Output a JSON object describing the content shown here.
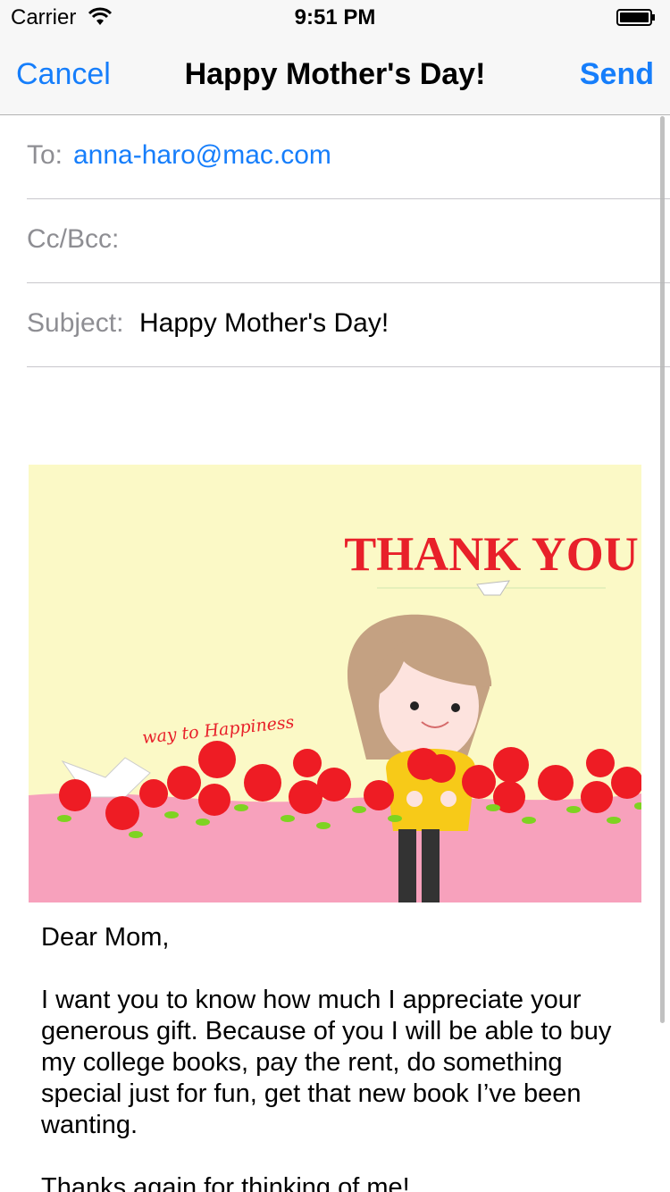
{
  "status_bar": {
    "carrier": "Carrier",
    "time": "9:51 PM",
    "icons": [
      "wifi-icon",
      "battery-icon"
    ]
  },
  "nav": {
    "cancel_label": "Cancel",
    "title": "Happy Mother's Day!",
    "send_label": "Send"
  },
  "fields": {
    "to_label": "To:",
    "to_value": "anna-haro@mac.com",
    "cc_label": "Cc/Bcc:",
    "cc_value": "",
    "subject_label": "Subject:",
    "subject_value": "Happy Mother's Day!"
  },
  "card": {
    "headline": "THANK YOU",
    "tagline": "way to Happiness",
    "colors": {
      "background": "#fbf9c6",
      "ground": "#f7a1bc",
      "roses": "#ee1c24",
      "headline": "#e8202a"
    }
  },
  "body": {
    "greeting": "Dear Mom,",
    "paragraph1": "I want you to know how much I appreciate your generous gift. Because of you I will be able to buy my college books, pay the rent, do something special just for fun, get that new book I’ve been wanting.",
    "paragraph2": "Thanks again for thinking of me!"
  },
  "accent_color": "#167efb"
}
